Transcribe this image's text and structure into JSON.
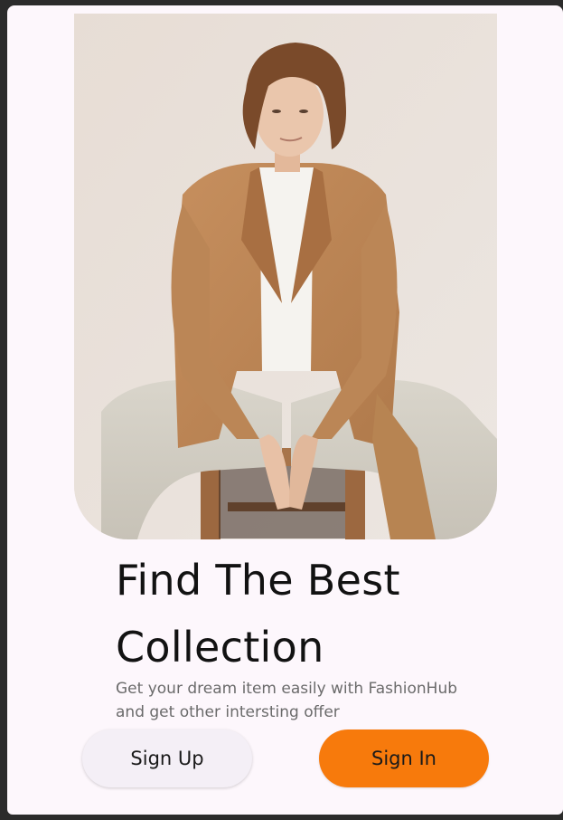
{
  "screen": {
    "title_line1": "Find The Best",
    "title_line2": "Collection",
    "subtitle_line1": "Get your dream item easily with FashionHub",
    "subtitle_line2": "and get other intersting offer"
  },
  "buttons": {
    "sign_up": "Sign Up",
    "sign_in": "Sign In"
  },
  "colors": {
    "background": "#fdf7fc",
    "accent": "#f77a0c",
    "secondary_button": "#f4eff6"
  }
}
